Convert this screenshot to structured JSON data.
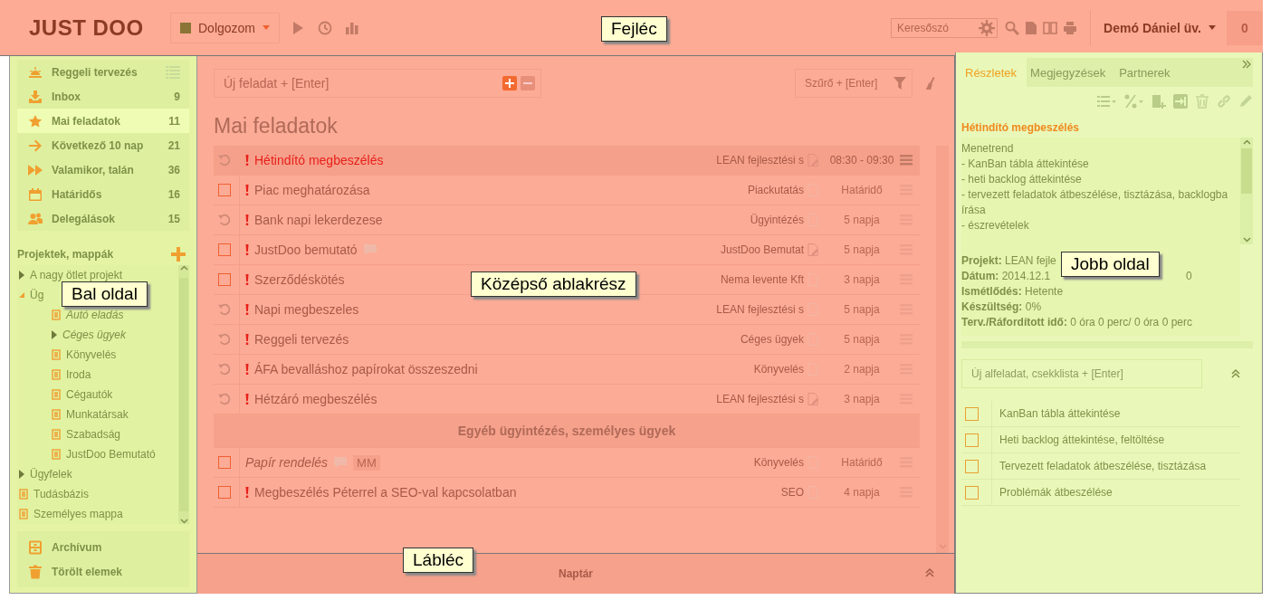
{
  "header": {
    "logo": "JUST DOO",
    "status": {
      "label": "Dolgozom",
      "color": "#8a7436"
    },
    "search": {
      "placeholder": "Keresőszó"
    },
    "user": "Demó Dániel üv.",
    "notifications": "0"
  },
  "sidebar": {
    "items": [
      {
        "label": "Reggeli tervezés",
        "selected": false
      },
      {
        "label": "Inbox",
        "count": "9",
        "selected": false
      },
      {
        "label": "Mai feladatok",
        "count": "11",
        "selected": true
      },
      {
        "label": "Következő 10 nap",
        "count": "21",
        "selected": false
      },
      {
        "label": "Valamikor, talán",
        "count": "36",
        "selected": false
      },
      {
        "label": "Határidős",
        "count": "16",
        "selected": false
      },
      {
        "label": "Delegálások",
        "count": "15",
        "selected": false
      }
    ],
    "projects_title": "Projektek, mappák",
    "tree": [
      {
        "label": "A nagy ötlet projekt",
        "kind": "folder",
        "expanded": false,
        "italic": false
      },
      {
        "label": "Üg",
        "kind": "folder",
        "expanded": true,
        "italic": false,
        "children": [
          {
            "label": "Autó eladás",
            "kind": "list",
            "italic": true
          },
          {
            "label": "Céges ügyek",
            "kind": "folder",
            "expanded": false,
            "italic": true
          },
          {
            "label": "Könyvelés",
            "kind": "list",
            "italic": false
          },
          {
            "label": "Iroda",
            "kind": "list",
            "italic": false
          },
          {
            "label": "Cégautók",
            "kind": "list",
            "italic": false
          },
          {
            "label": "Munkatársak",
            "kind": "list",
            "italic": false
          },
          {
            "label": "Szabadság",
            "kind": "list",
            "italic": false
          },
          {
            "label": "JustDoo Bemutató",
            "kind": "list",
            "italic": false
          }
        ]
      },
      {
        "label": "Ügyfelek",
        "kind": "folder",
        "expanded": false,
        "italic": false
      },
      {
        "label": "Tudásbázis",
        "kind": "list",
        "italic": false
      },
      {
        "label": "Személyes mappa",
        "kind": "list",
        "italic": false
      }
    ],
    "bottom": [
      {
        "label": "Archívum"
      },
      {
        "label": "Törölt elemek"
      }
    ]
  },
  "center": {
    "new_task": {
      "placeholder": "Új feladat + [Enter]"
    },
    "filter": {
      "placeholder": "Szűrő + [Enter]"
    },
    "title": "Mai feladatok",
    "tasks": [
      {
        "kind": "recurring",
        "title": "Hétindító megbeszélés",
        "important": true,
        "italic": false,
        "selected": true,
        "comment": false,
        "project": "LEAN fejlesztési s",
        "note_edited": true,
        "due": "08:30 - 09:30"
      },
      {
        "kind": "task",
        "checked": false,
        "title": "Piac meghatározása",
        "important": true,
        "italic": false,
        "selected": false,
        "comment": false,
        "project": "Piackutatás",
        "note_edited": false,
        "due": "Határidő"
      },
      {
        "kind": "recurring",
        "title": "Bank napi lekerdezese",
        "important": true,
        "italic": false,
        "selected": false,
        "comment": false,
        "project": "Ügyintézés",
        "note_edited": false,
        "due": "5 napja"
      },
      {
        "kind": "task",
        "checked": false,
        "title": "JustDoo bemutató",
        "important": true,
        "italic": false,
        "selected": false,
        "comment": true,
        "project": "JustDoo Bemutat",
        "note_edited": true,
        "due": "5 napja"
      },
      {
        "kind": "task",
        "checked": false,
        "title": "Szerződéskötés",
        "important": true,
        "italic": false,
        "selected": false,
        "comment": false,
        "project": "Nema levente Kft",
        "note_edited": false,
        "due": "3 napja"
      },
      {
        "kind": "recurring",
        "title": "Napi megbeszeles",
        "important": true,
        "italic": false,
        "selected": false,
        "comment": false,
        "project": "LEAN fejlesztési s",
        "note_edited": false,
        "due": "5 napja"
      },
      {
        "kind": "recurring",
        "title": "Reggeli tervezés",
        "important": true,
        "italic": false,
        "selected": false,
        "comment": false,
        "project": "Céges ügyek",
        "note_edited": false,
        "due": "5 napja"
      },
      {
        "kind": "recurring",
        "title": "ÁFA bevalláshoz papírokat összeszedni",
        "important": true,
        "italic": false,
        "selected": false,
        "comment": false,
        "project": "Könyvelés",
        "note_edited": false,
        "due": "2 napja"
      },
      {
        "kind": "recurring",
        "title": "Hétzáró megbeszélés",
        "important": true,
        "italic": false,
        "selected": false,
        "comment": false,
        "project": "LEAN fejlesztési s",
        "note_edited": true,
        "due": "3 napja"
      },
      {
        "kind": "section",
        "title": "Egyéb ügyintézés, személyes ügyek"
      },
      {
        "kind": "task",
        "checked": false,
        "title": "Papír rendelés",
        "important": false,
        "italic": true,
        "selected": false,
        "comment": true,
        "tag": "MM",
        "project": "Könyvelés",
        "note_edited": false,
        "due": "Határidő"
      },
      {
        "kind": "task",
        "checked": false,
        "title": "Megbeszélés Péterrel a SEO-val kapcsolatban",
        "important": true,
        "italic": false,
        "selected": false,
        "comment": false,
        "project": "SEO",
        "note_edited": false,
        "due": "4 napja"
      }
    ],
    "footer": "Naptár"
  },
  "details": {
    "tabs": [
      {
        "label": "Részletek",
        "selected": true
      },
      {
        "label": "Megjegyzések",
        "selected": false
      },
      {
        "label": "Partnerek",
        "selected": false
      }
    ],
    "task_title": "Hétindító megbeszélés",
    "description": [
      "Menetrend",
      "- KanBan tábla áttekintése",
      "- heti backlog áttekintése",
      "- tervezett feladatok átbeszélése, tisztázása, backlogba írása",
      "- észrevételek"
    ],
    "fields": [
      {
        "label": "Projekt:",
        "value": "LEAN fejle"
      },
      {
        "label": "Dátum:",
        "value": "2014.12.1",
        "tail": "0"
      },
      {
        "label": "Ismétlődés:",
        "value": "Hetente"
      },
      {
        "label": "Készültség:",
        "value": "0%"
      },
      {
        "label": "Terv./Ráfordított idő:",
        "value": "0 óra 0 perc/ 0 óra 0 perc"
      }
    ],
    "subtask": {
      "placeholder": "Új alfeladat, csekklista + [Enter]"
    },
    "checklist": [
      {
        "label": "KanBan tábla áttekintése",
        "checked": false
      },
      {
        "label": "Heti backlog áttekintése, feltöltése",
        "checked": false
      },
      {
        "label": "Tervezett feladatok átbeszélése, tisztázása",
        "checked": false
      },
      {
        "label": "Problémák átbeszélése",
        "checked": false
      }
    ]
  },
  "annotations": [
    {
      "label": "Fejléc"
    },
    {
      "label": "Bal oldal"
    },
    {
      "label": "Középső ablakrész"
    },
    {
      "label": "Lábléc"
    },
    {
      "label": "Jobb oldal"
    }
  ]
}
